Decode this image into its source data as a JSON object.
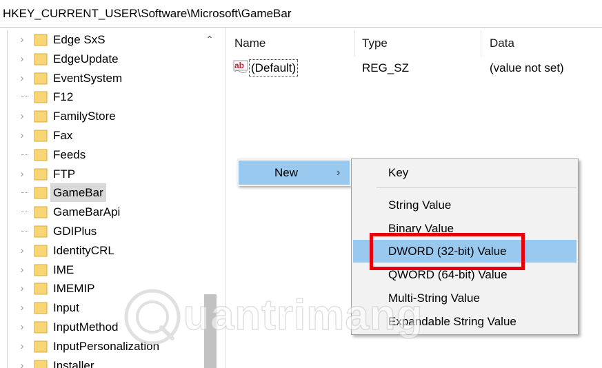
{
  "address": {
    "path": "HKEY_CURRENT_USER\\Software\\Microsoft\\GameBar"
  },
  "tree": {
    "items": [
      {
        "label": "Edge SxS",
        "expandable": true
      },
      {
        "label": "EdgeUpdate",
        "expandable": true
      },
      {
        "label": "EventSystem",
        "expandable": true
      },
      {
        "label": "F12",
        "expandable": false
      },
      {
        "label": "FamilyStore",
        "expandable": true
      },
      {
        "label": "Fax",
        "expandable": true
      },
      {
        "label": "Feeds",
        "expandable": false
      },
      {
        "label": "FTP",
        "expandable": true
      },
      {
        "label": "GameBar",
        "expandable": false,
        "selected": true
      },
      {
        "label": "GameBarApi",
        "expandable": false
      },
      {
        "label": "GDIPlus",
        "expandable": false
      },
      {
        "label": "IdentityCRL",
        "expandable": true
      },
      {
        "label": "IME",
        "expandable": true
      },
      {
        "label": "IMEMIP",
        "expandable": true
      },
      {
        "label": "Input",
        "expandable": true
      },
      {
        "label": "InputMethod",
        "expandable": true
      },
      {
        "label": "InputPersonalization",
        "expandable": true
      },
      {
        "label": "Installer",
        "expandable": true
      }
    ]
  },
  "list": {
    "columns": {
      "name": "Name",
      "type": "Type",
      "data": "Data"
    },
    "rows": [
      {
        "icon": "string-value-icon",
        "name": "(Default)",
        "type": "REG_SZ",
        "data": "(value not set)"
      }
    ]
  },
  "context_menu": {
    "new_label": "New",
    "submenu": {
      "key": "Key",
      "items": [
        "String Value",
        "Binary Value",
        "DWORD (32-bit) Value",
        "QWORD (64-bit) Value",
        "Multi-String Value",
        "Expandable String Value"
      ],
      "hovered": "DWORD (32-bit) Value"
    }
  },
  "watermark": {
    "text": "uantrimang"
  },
  "colors": {
    "menu_highlight": "#99c9ef",
    "annotation_box": "#e8000b",
    "folder": "#f8d675",
    "selected_tree_item": "#d9d9d9"
  }
}
